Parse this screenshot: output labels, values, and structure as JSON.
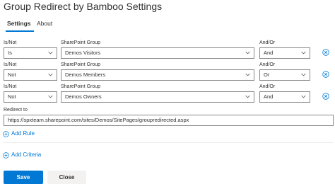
{
  "title": "Group Redirect by Bamboo Settings",
  "tabs": [
    {
      "label": "Settings",
      "active": true
    },
    {
      "label": "About",
      "active": false
    }
  ],
  "rule_labels": {
    "is_not": "Is/Not",
    "sharepoint_group": "SharePoint Group",
    "and_or": "And/Or"
  },
  "rules": [
    {
      "is_not": "Is",
      "group": "Demos Visitors",
      "and_or": "And"
    },
    {
      "is_not": "Not",
      "group": "Demos Members",
      "and_or": "Or"
    },
    {
      "is_not": "Not",
      "group": "Demos Owners",
      "and_or": "And"
    }
  ],
  "redirect": {
    "label": "Redirect to",
    "value": "https://spxteam.sharepoint.com/sites/Demos/SitePages/groupredirected.aspx"
  },
  "actions": {
    "add_rule": "Add Rule",
    "add_criteria": "Add Criteria"
  },
  "buttons": {
    "save": "Save",
    "close": "Close"
  },
  "colors": {
    "accent": "#0078d4",
    "text": "#323130",
    "border": "#8a8886",
    "secondary_button": "#f3f2f1"
  },
  "icons": {
    "dropdown": "chevron-down-icon",
    "remove": "remove-circle-icon",
    "add": "add-circle-icon"
  }
}
